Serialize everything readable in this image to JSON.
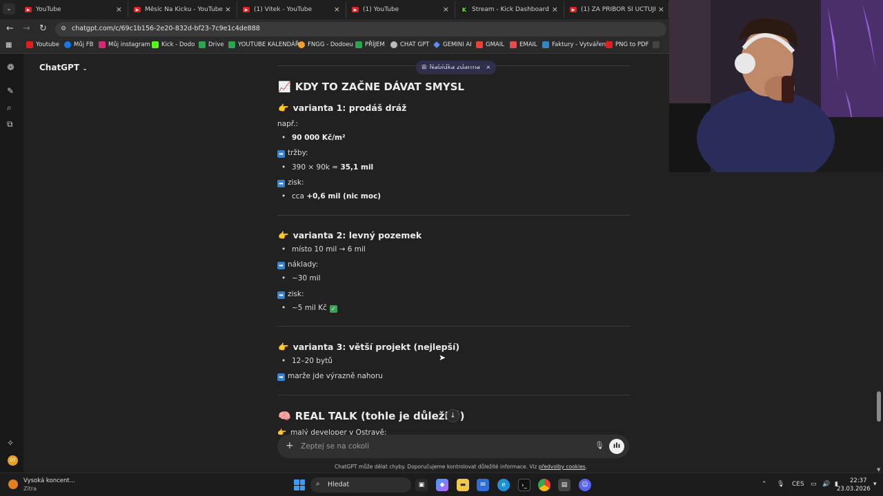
{
  "browser": {
    "tabs": [
      {
        "label": "YouTube",
        "icon": "youtube-icon",
        "color": "#e02020"
      },
      {
        "label": "Měsíc Na Kicku - YouTube",
        "icon": "youtube-icon",
        "color": "#e02020"
      },
      {
        "label": "(1) Vítek - YouTube",
        "icon": "youtube-icon",
        "color": "#e02020"
      },
      {
        "label": "(1) YouTube",
        "icon": "youtube-icon",
        "color": "#e02020"
      },
      {
        "label": "Stream - Kick Dashboard",
        "icon": "kick-icon",
        "color": "#53fc18"
      },
      {
        "label": "(1) ZA PŘÍBOR SI ÚČTUJÍ 150Kč",
        "icon": "youtube-icon",
        "color": "#e02020"
      }
    ],
    "url": "chatgpt.com/c/69c1b156-2e20-832d-bf23-7c9e1c4de888",
    "bookmarks": [
      {
        "label": "Youtube",
        "color": "#e02020"
      },
      {
        "label": "Můj FB",
        "color": "#1877f2"
      },
      {
        "label": "Můj instagram",
        "color": "#d62976"
      },
      {
        "label": "Kick - Dodo",
        "color": "#53fc18"
      },
      {
        "label": "Drive",
        "color": "#2ea44f"
      },
      {
        "label": "YOUTUBE KALENDÁŘ",
        "color": "#2ea44f"
      },
      {
        "label": "FNGG - Dodoeu",
        "color": "#f0a030"
      },
      {
        "label": "PŘÍJEM",
        "color": "#2ea44f"
      },
      {
        "label": "CHAT GPT",
        "color": "#bbbbbb"
      },
      {
        "label": "GEMINI AI",
        "color": "#5a8dee"
      },
      {
        "label": "GMAIL",
        "color": "#ea4335"
      },
      {
        "label": "EMAIL",
        "color": "#e05050"
      },
      {
        "label": "Faktury - Vytváření",
        "color": "#3b82c4"
      },
      {
        "label": "PNG to PDF",
        "color": "#e02020"
      }
    ]
  },
  "chatgpt": {
    "model": "ChatGPT",
    "promo": "Nabídka zdarma",
    "composer_placeholder": "Zeptej se na cokoli",
    "disclaimer_text": "ChatGPT může dělat chyby. Doporučujeme kontrolovat důležité informace. Viz ",
    "disclaimer_link": "předvolby cookies",
    "disclaimer_end": "."
  },
  "content": {
    "heading1": "KDY TO ZAČNE DÁVAT SMYSL",
    "v1_title": "varianta 1: prodáš dráž",
    "v1_intro": "např.:",
    "v1_item1": "90 000 Kč/m²",
    "v1_label_trzby": "tržby:",
    "v1_item2_pre": "390 × 90k = ",
    "v1_item2_bold": "35,1 mil",
    "v1_label_zisk": "zisk:",
    "v1_item3_pre": "cca ",
    "v1_item3_bold": "+0,6 mil (nic moc)",
    "v2_title": "varianta 2: levný pozemek",
    "v2_item1": "místo 10 mil → 6 mil",
    "v2_label_naklady": "náklady:",
    "v2_item2": "~30 mil",
    "v2_label_zisk": "zisk:",
    "v2_item3": "~5 mil Kč",
    "v3_title": "varianta 3: větší projekt (nejlepší)",
    "v3_item1": "12–20 bytů",
    "v3_note": "marže jde výrazně nahoru",
    "heading2": "REAL TALK (tohle je důležitý)",
    "cut_line": "malý developer v Ostravě:"
  },
  "taskbar": {
    "weather_title": "Vysoká koncent...",
    "weather_sub": "Zítra",
    "search_placeholder": "Hledat",
    "lang": "CES",
    "time": "22:37",
    "date": "23.03.2026"
  },
  "colors": {
    "background": "#212121",
    "accent": "#3b82c4"
  }
}
